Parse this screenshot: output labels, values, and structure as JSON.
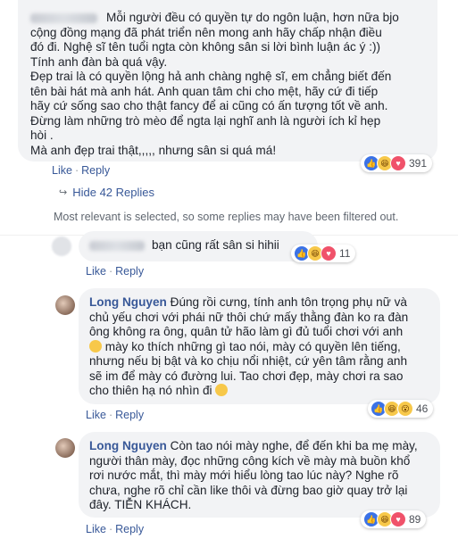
{
  "comments": [
    {
      "author": "",
      "lines": [
        "Mỗi người đều có quyền tự do ngôn luận, hơn nữa bjo",
        "cộng đồng mạng đã phát triển nên mong anh hãy chấp nhận điều",
        "đó đi. Nghệ sĩ tên tuổi ngta còn không sân si lời bình luận ác ý :))",
        "Tính anh đàn bà quá vậy.",
        "Đẹp trai là có quyền lộng hả anh chàng nghệ sĩ, em chẳng biết đến",
        "tên bài hát mà anh hát. Anh quan tâm chi cho mệt, hãy cứ đi tiếp",
        "hãy cứ sống sao cho thật fancy để ai cũng có ấn tượng tốt về anh.",
        "Đừng làm những trò mèo để ngta lại nghĩ anh là người ích kỉ hẹp",
        "hòi .",
        "Mà anh đẹp trai thật,,,,, nhưng sân si quá má!"
      ],
      "like": "Like",
      "reply": "Reply",
      "reaction_count": "391"
    },
    {
      "author": "",
      "lines": [
        "bạn cũng rất sân si hihii"
      ],
      "like": "Like",
      "reply": "Reply",
      "reaction_count": "11"
    },
    {
      "author": "Long Nguyen",
      "lines": [
        "Đúng rồi cưng, tính anh tôn trọng phụ nữ và",
        "chủ yếu chơi với phái nữ thôi chứ mấy thằng đàn ko ra đàn",
        "ông không ra ông, quân tử hão làm gì đủ tuổi chơi với anh",
        "mày ko thích những gì tao nói, mày có quyền lên tiếng,",
        "nhưng nếu bị bật và ko chịu nổi nhiệt, cứ yên tâm rằng anh",
        "sẽ im để mày có đường lui. Tao chơi đẹp, mày chơi ra sao",
        "cho thiên hạ nó nhìn đi"
      ],
      "like": "Like",
      "reply": "Reply",
      "reaction_count": "46"
    },
    {
      "author": "Long Nguyen",
      "lines": [
        "Còn tao nói mày nghe, để đến khi ba mẹ mày,",
        "người thân mày, đọc những công kích về mày mà buồn khổ",
        "rơi nước mắt, thì mày mới hiểu lòng tao lúc này? Nghe rõ",
        "chưa, nghe rõ chỉ cần like thôi và đừng bao giờ quay trở lại",
        "đây. TIỄN KHÁCH."
      ],
      "like": "Like",
      "reply": "Reply",
      "reaction_count": "89"
    }
  ],
  "hide_replies": "Hide 42 Replies",
  "filter_note": "Most relevant is selected, so some replies may have been filtered out.",
  "colors": {
    "link": "#385898",
    "bubble": "#f2f3f5",
    "like_blue": "#3b72e6"
  },
  "icons": [
    "like-icon",
    "haha-icon",
    "love-icon",
    "wow-icon",
    "smile-emoji-icon",
    "reply-arrow-icon"
  ]
}
